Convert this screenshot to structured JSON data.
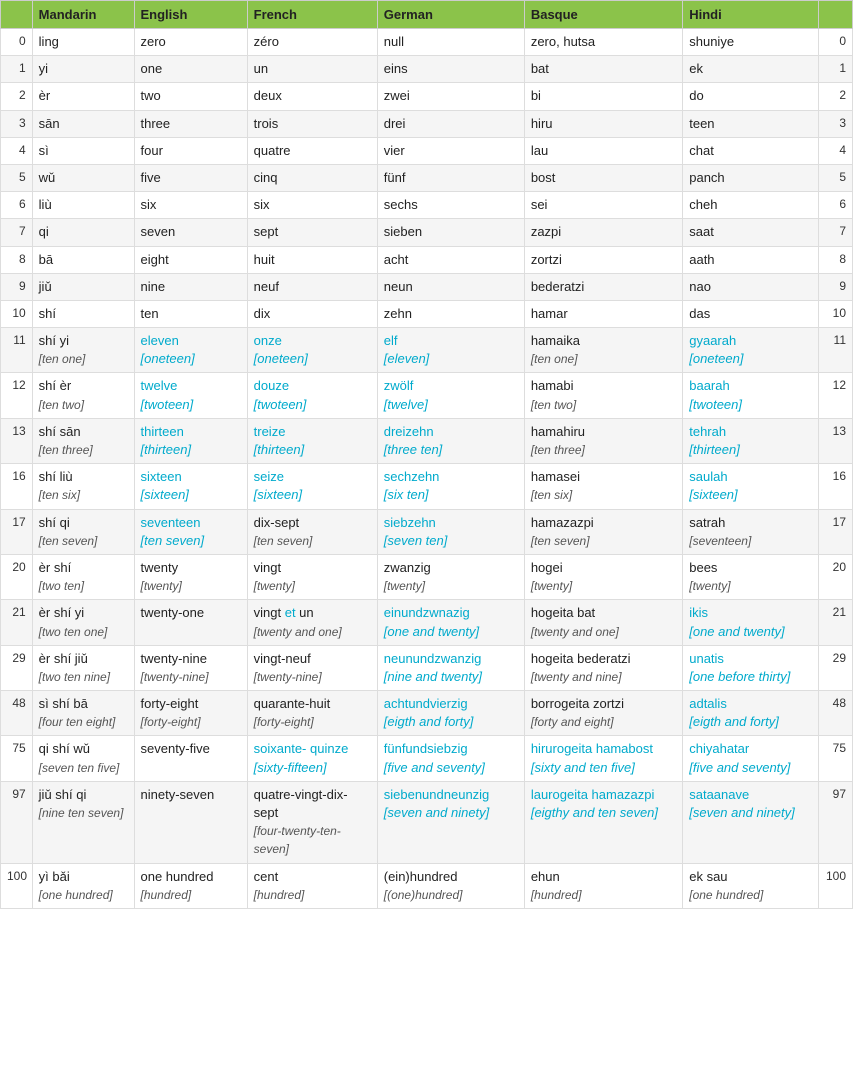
{
  "headers": [
    "",
    "Mandarin",
    "English",
    "French",
    "German",
    "Basque",
    "Hindi",
    ""
  ],
  "rows": [
    {
      "num": "0",
      "mandarin": "ling",
      "english": "zero",
      "french": "zéro",
      "german": "null",
      "basque": "zero, hutsa",
      "hindi": "shuniye",
      "num2": "0",
      "highlighted": []
    },
    {
      "num": "1",
      "mandarin": "yi",
      "english": "one",
      "french": "un",
      "german": "eins",
      "basque": "bat",
      "hindi": "ek",
      "num2": "1",
      "highlighted": []
    },
    {
      "num": "2",
      "mandarin": "èr",
      "english": "two",
      "french": "deux",
      "german": "zwei",
      "basque": "bi",
      "hindi": "do",
      "num2": "2",
      "highlighted": []
    },
    {
      "num": "3",
      "mandarin": "sān",
      "english": "three",
      "french": "trois",
      "german": "drei",
      "basque": "hiru",
      "hindi": "teen",
      "num2": "3",
      "highlighted": []
    },
    {
      "num": "4",
      "mandarin": "sì",
      "english": "four",
      "french": "quatre",
      "german": "vier",
      "basque": "lau",
      "hindi": "chat",
      "num2": "4",
      "highlighted": []
    },
    {
      "num": "5",
      "mandarin": "wǔ",
      "english": "five",
      "french": "cinq",
      "german": "fünf",
      "basque": "bost",
      "hindi": "panch",
      "num2": "5",
      "highlighted": []
    },
    {
      "num": "6",
      "mandarin": "liù",
      "english": "six",
      "french": "six",
      "german": "sechs",
      "basque": "sei",
      "hindi": "cheh",
      "num2": "6",
      "highlighted": []
    },
    {
      "num": "7",
      "mandarin": "qi",
      "english": "seven",
      "french": "sept",
      "german": "sieben",
      "basque": "zazpi",
      "hindi": "saat",
      "num2": "7",
      "highlighted": []
    },
    {
      "num": "8",
      "mandarin": "bā",
      "english": "eight",
      "french": "huit",
      "german": "acht",
      "basque": "zortzi",
      "hindi": "aath",
      "num2": "8",
      "highlighted": []
    },
    {
      "num": "9",
      "mandarin": "jiǔ",
      "english": "nine",
      "french": "neuf",
      "german": "neun",
      "basque": "bederatzi",
      "hindi": "nao",
      "num2": "9",
      "highlighted": []
    },
    {
      "num": "10",
      "mandarin": "shí",
      "english": "ten",
      "french": "dix",
      "german": "zehn",
      "basque": "hamar",
      "hindi": "das",
      "num2": "10",
      "highlighted": []
    },
    {
      "num": "11",
      "mandarin": "shí yi\n[ten one]",
      "english": "eleven",
      "english_sub": "[oneteen]",
      "french": "onze",
      "french_sub": "[oneteen]",
      "german": "elf",
      "german_sub": "[eleven]",
      "basque": "hamaika\n[ten one]",
      "hindi": "gyaarah",
      "hindi_sub": "[oneteen]",
      "num2": "11",
      "highlighted": [
        "english",
        "french",
        "german",
        "hindi"
      ]
    },
    {
      "num": "12",
      "mandarin": "shí èr\n[ten two]",
      "english": "twelve",
      "english_sub": "[twoteen]",
      "french": "douze",
      "french_sub": "[twoteen]",
      "german": "zwölf",
      "german_sub": "[twelve]",
      "basque": "hamabi\n[ten two]",
      "hindi": "baarah",
      "hindi_sub": "[twoteen]",
      "num2": "12",
      "highlighted": [
        "english",
        "french",
        "german",
        "hindi"
      ]
    },
    {
      "num": "13",
      "mandarin": "shí sān\n[ten three]",
      "english": "thirteen",
      "english_sub": "[thirteen]",
      "french": "treize",
      "french_sub": "[thirteen]",
      "german": "dreizehn",
      "german_sub": "[three ten]",
      "basque": "hamahiru\n[ten three]",
      "hindi": "tehrah",
      "hindi_sub": "[thirteen]",
      "num2": "13",
      "highlighted": [
        "english",
        "french",
        "german",
        "hindi"
      ]
    },
    {
      "num": "16",
      "mandarin": "shí liù\n[ten six]",
      "english": "sixteen",
      "english_sub": "[sixteen]",
      "french": "seize",
      "french_sub": "[sixteen]",
      "german": "sechzehn",
      "german_sub": "[six ten]",
      "basque": "hamasei\n[ten six]",
      "hindi": "saulah",
      "hindi_sub": "[sixteen]",
      "num2": "16",
      "highlighted": [
        "english",
        "french",
        "german",
        "hindi"
      ]
    },
    {
      "num": "17",
      "mandarin": "shí qi\n[ten seven]",
      "english": "seventeen",
      "english_sub": "[ten seven]",
      "french": "dix-sept\n[ten seven]",
      "german": "siebzehn",
      "german_sub": "[seven ten]",
      "basque": "hamazazpi\n[ten seven]",
      "hindi": "satrah\n[seventeen]",
      "num2": "17",
      "highlighted": [
        "english",
        "german"
      ]
    },
    {
      "num": "20",
      "mandarin": "èr shí\n[two ten]",
      "english": "twenty\n[twenty]",
      "french": "vingt\n[twenty]",
      "german": "zwanzig\n[twenty]",
      "basque": "hogei\n[twenty]",
      "hindi": "bees\n[twenty]",
      "num2": "20",
      "highlighted": []
    },
    {
      "num": "21",
      "mandarin": "èr shí yi\n[two ten one]",
      "english": "twenty-one",
      "french": "vingt et un\n[twenty and one]",
      "french_et": true,
      "german": "einundzwnazig\n[one and twenty]",
      "basque": "hogeita bat\n[twenty and one]",
      "hindi": "ikis\n[one and twenty]",
      "num2": "21",
      "highlighted": [
        "german",
        "hindi"
      ]
    },
    {
      "num": "29",
      "mandarin": "èr shí jiǔ\n[two ten nine]",
      "english": "twenty-nine\n[twenty-nine]",
      "french": "vingt-neuf\n[twenty-nine]",
      "german": "neunundzwanzig\n[nine and twenty]",
      "basque": "hogeita bederatzi\n[twenty and nine]",
      "hindi": "unatis\n[one before thirty]",
      "num2": "29",
      "highlighted": [
        "german",
        "hindi"
      ]
    },
    {
      "num": "48",
      "mandarin": "sì shí bā\n[four ten eight]",
      "english": "forty-eight\n[forty-eight]",
      "french": "quarante-huit\n[forty-eight]",
      "german": "achtundvierzig\n[eigth and forty]",
      "basque": "borrogeita zortzi\n[forty and eight]",
      "hindi": "adtalis\n[eigth and forty]",
      "num2": "48",
      "highlighted": [
        "german",
        "hindi"
      ]
    },
    {
      "num": "75",
      "mandarin": "qi shí wǔ\n[seven ten five]",
      "english": "seventy-five",
      "french": "soixante- quinze\n[sixty-fifteen]",
      "german": "fünfundsiebzig\n[five and seventy]",
      "basque": "hirurogeita hamabost\n[sixty and ten five]",
      "hindi": "chiyahatar\n[five and seventy]",
      "num2": "75",
      "highlighted": [
        "french",
        "german",
        "basque",
        "hindi"
      ]
    },
    {
      "num": "97",
      "mandarin": "jiǔ shí qi\n[nine ten seven]",
      "english": "ninety-seven",
      "french": "quatre-vingt-dix-sept\n[four-twenty-ten-seven]",
      "german": "siebenundneunzig\n[seven and ninety]",
      "basque": "laurogeita hamazazpi\n[eigthy and ten seven]",
      "hindi": "sataanave\n[seven and ninety]",
      "num2": "97",
      "highlighted": [
        "german",
        "basque",
        "hindi"
      ]
    },
    {
      "num": "100",
      "mandarin": "yì bǎi\n[one hundred]",
      "english": "one hundred\n[hundred]",
      "french": "cent\n[hundred]",
      "german": "(ein)hundred\n[(one)hundred]",
      "basque": "ehun\n[hundred]",
      "hindi": "ek sau\n[one hundred]",
      "num2": "100",
      "highlighted": []
    }
  ]
}
